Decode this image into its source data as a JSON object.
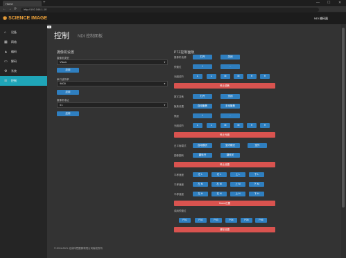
{
  "browser": {
    "tab_title": "Home",
    "new_tab": "+",
    "url": "http://192.168.1.10",
    "win_min": "—",
    "win_max": "☐",
    "win_close": "✕",
    "back": "←",
    "forward": "→",
    "reload": "⟳"
  },
  "header": {
    "logo": "SCIENCE IMAGE",
    "user": "NDI 编码器"
  },
  "sidebar": {
    "items": [
      {
        "label": "设备",
        "icon": "home-icon",
        "glyph": "⌂"
      },
      {
        "label": "网络",
        "icon": "network-icon",
        "glyph": "▦"
      },
      {
        "label": "编码",
        "icon": "chart-icon",
        "glyph": "▲"
      },
      {
        "label": "解码",
        "icon": "monitor-icon",
        "glyph": "▭"
      },
      {
        "label": "系统",
        "icon": "gear-icon",
        "glyph": "⚙"
      },
      {
        "label": "控制",
        "icon": "control-icon",
        "glyph": "☰"
      }
    ]
  },
  "collapse_label": "≡",
  "page": {
    "title": "控制",
    "subtitle": "NDI 控制面板"
  },
  "cam": {
    "title": "摄像机设置",
    "protocol_label": "摄像机类型",
    "protocol_value": "Visca",
    "apply1": "应用",
    "baud_label": "串口波特率",
    "baud_value": "9600",
    "apply2": "应用",
    "addr_label": "摄像机地址",
    "addr_value": "01",
    "apply3": "应用"
  },
  "ptz": {
    "title": "PTZ控制面板",
    "r1_label": "摄像机电源",
    "r1_b1": "打开",
    "r1_b2": "关闭",
    "r2_label": "预置位",
    "r2_b1": "+",
    "r2_b2": "-",
    "r3_label": "光圈调节",
    "r3_b": [
      "L",
      "L",
      "M",
      "M",
      "H",
      "H"
    ],
    "bar1": "停止调焦",
    "r4_label": "数字变焦",
    "r4_b1": "打开",
    "r4_b2": "关闭",
    "r5_label": "聚焦设置",
    "r5_b1": "自动聚焦",
    "r5_b2": "手动聚焦",
    "r6_label": "焦距",
    "r6_b1": "+",
    "r6_b2": "-",
    "r7_label": "光圈调节",
    "r7_b": [
      "L",
      "L",
      "M",
      "M",
      "H",
      "H"
    ],
    "bar2": "停止光圈",
    "r8_label": "白平衡模式",
    "r8_b": [
      "自动模式",
      "室内模式",
      "室外"
    ],
    "r9_label": "图像翻转",
    "r9_b": [
      "翻转开",
      "翻转关"
    ],
    "bar3": "停止设置",
    "r10_label": "平移速度",
    "r10_b": [
      "左 L",
      "右 L",
      "上 L",
      "下 L"
    ],
    "r11_label": "平移速度",
    "r11_b": [
      "左 M",
      "右 M",
      "上 M",
      "下 M"
    ],
    "r12_label": "平移速度",
    "r12_b": [
      "左 H",
      "右 H",
      "上 H",
      "下 H"
    ],
    "bar4": "Home位置",
    "r13_label": "调用预置位",
    "presets": [
      "P01",
      "P02",
      "P03",
      "P04",
      "P05",
      "P06"
    ],
    "bar5": "清除设置"
  },
  "footer": "© 2011-2021 北京科思图像有限公司版权所有",
  "colors": {
    "accent": "#1fa5b8",
    "button": "#2f7fc0",
    "danger": "#d9534f",
    "logo": "#f0a33a"
  }
}
